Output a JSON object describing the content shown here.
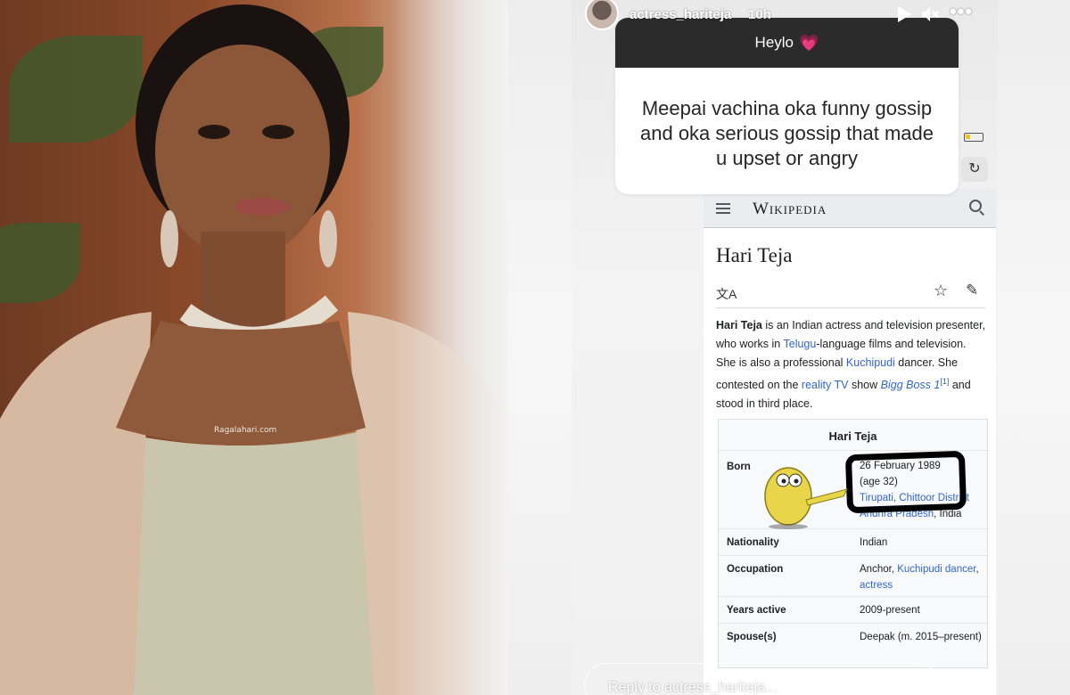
{
  "story": {
    "username": "actress_hariteja",
    "time_ago": "10h",
    "question": {
      "title": "Heylo",
      "title_emoji": "💗",
      "text": "Meepai vachina oka funny gossip and oka serious gossip that made u upset or angry"
    },
    "reply_placeholder": "Reply to actress_hariteja..."
  },
  "photo": {
    "watermark": "Ragalahari.com"
  },
  "wiki": {
    "logo": "Wikipedia",
    "title": "Hari Teja",
    "lead": {
      "name": "Hari Teja",
      "t1": " is an Indian actress and television presenter, who works in ",
      "link_telugu": "Telugu",
      "t2": "-language films and television. She is also a professional ",
      "link_kuchipudi": "Kuchipudi",
      "t3": " dancer. She contested on the ",
      "link_reality": "reality TV",
      "t4": " show ",
      "link_bigg": "Bigg Boss 1",
      "ref": "[1]",
      "t5": " and stood in third place."
    },
    "infobox": {
      "title": "Hari Teja",
      "born_label": "Born",
      "born_date": "26 February 1989",
      "born_age": "(age 32)",
      "born_place_link1": "Tirupati, Chittoor District",
      "born_place_link2": "Andhra Pradesh",
      "born_place_tail": ", India",
      "nationality_label": "Nationality",
      "nationality_value": "Indian",
      "occupation_label": "Occupation",
      "occupation_v1": "Anchor, ",
      "occupation_link1": "Kuchipudi dancer",
      "occupation_sep": ", ",
      "occupation_link2": "actress",
      "years_label": "Years active",
      "years_value": "2009-present",
      "spouse_label": "Spouse(s)",
      "spouse_value": "Deepak (m. 2015–present)"
    }
  }
}
